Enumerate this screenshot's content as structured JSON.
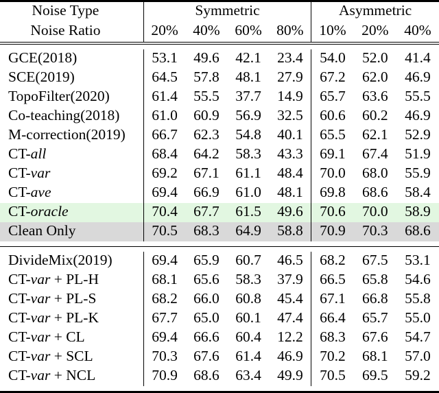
{
  "table": {
    "header": {
      "label_line1": "Noise Type",
      "label_line2": "Noise Ratio",
      "groups": [
        {
          "name": "Symmetric",
          "ratios": [
            "20%",
            "40%",
            "60%",
            "80%"
          ]
        },
        {
          "name": "Asymmetric",
          "ratios": [
            "10%",
            "20%",
            "40%"
          ]
        }
      ]
    },
    "highlight_colors": {
      "oracle_row": "#e2f7e1",
      "clean_only_row": "#d9d9d9"
    },
    "sections": [
      {
        "rows": [
          {
            "label_pre": "GCE(2018)",
            "label_it": "",
            "label_post": "",
            "values": [
              "53.1",
              "49.6",
              "42.1",
              "23.4",
              "54.0",
              "52.0",
              "41.4"
            ],
            "bold": [
              false,
              false,
              false,
              false,
              false,
              false,
              false
            ],
            "highlight": ""
          },
          {
            "label_pre": "SCE(2019)",
            "label_it": "",
            "label_post": "",
            "values": [
              "64.5",
              "57.8",
              "48.1",
              "27.9",
              "67.2",
              "62.0",
              "46.9"
            ],
            "bold": [
              false,
              false,
              false,
              false,
              false,
              false,
              false
            ],
            "highlight": ""
          },
          {
            "label_pre": "TopoFilter(2020)",
            "label_it": "",
            "label_post": "",
            "values": [
              "61.4",
              "55.5",
              "37.7",
              "14.9",
              "65.7",
              "63.6",
              "55.5"
            ],
            "bold": [
              false,
              false,
              false,
              false,
              false,
              false,
              false
            ],
            "highlight": ""
          },
          {
            "label_pre": "Co-teaching(2018)",
            "label_it": "",
            "label_post": "",
            "values": [
              "61.0",
              "60.9",
              "56.9",
              "32.5",
              "60.6",
              "60.2",
              "46.9"
            ],
            "bold": [
              false,
              false,
              false,
              false,
              false,
              false,
              false
            ],
            "highlight": ""
          },
          {
            "label_pre": "M-correction(2019)",
            "label_it": "",
            "label_post": "",
            "values": [
              "66.7",
              "62.3",
              "54.8",
              "40.1",
              "65.5",
              "62.1",
              "52.9"
            ],
            "bold": [
              false,
              false,
              false,
              false,
              false,
              false,
              false
            ],
            "highlight": ""
          },
          {
            "label_pre": "CT-",
            "label_it": "all",
            "label_post": "",
            "values": [
              "68.4",
              "64.2",
              "58.3",
              "43.3",
              "69.1",
              "67.4",
              "51.9"
            ],
            "bold": [
              false,
              false,
              false,
              false,
              false,
              false,
              false
            ],
            "highlight": ""
          },
          {
            "label_pre": "CT-",
            "label_it": "var",
            "label_post": "",
            "values": [
              "69.2",
              "67.1",
              "61.1",
              "48.4",
              "70.0",
              "68.0",
              "55.9"
            ],
            "bold": [
              false,
              true,
              true,
              true,
              true,
              false,
              false
            ],
            "highlight": ""
          },
          {
            "label_pre": "CT-",
            "label_it": "ave",
            "label_post": "",
            "values": [
              "69.4",
              "66.9",
              "61.0",
              "48.1",
              "69.8",
              "68.6",
              "58.4"
            ],
            "bold": [
              true,
              false,
              false,
              false,
              false,
              true,
              true
            ],
            "highlight": ""
          },
          {
            "label_pre": "CT-",
            "label_it": "oracle",
            "label_post": "",
            "values": [
              "70.4",
              "67.7",
              "61.5",
              "49.6",
              "70.6",
              "70.0",
              "58.9"
            ],
            "bold": [
              false,
              false,
              false,
              false,
              false,
              false,
              false
            ],
            "highlight": "green"
          },
          {
            "label_pre": "Clean Only",
            "label_it": "",
            "label_post": "",
            "values": [
              "70.5",
              "68.3",
              "64.9",
              "58.8",
              "70.9",
              "70.3",
              "68.6"
            ],
            "bold": [
              false,
              false,
              false,
              false,
              false,
              false,
              false
            ],
            "highlight": "gray"
          }
        ]
      },
      {
        "rows": [
          {
            "label_pre": "DivideMix(2019)",
            "label_it": "",
            "label_post": "",
            "values": [
              "69.4",
              "65.9",
              "60.7",
              "46.5",
              "68.2",
              "67.5",
              "53.1"
            ],
            "bold": [
              false,
              false,
              false,
              false,
              false,
              false,
              false
            ],
            "highlight": ""
          },
          {
            "label_pre": "CT-",
            "label_it": "var",
            "label_post": " + PL-H",
            "values": [
              "68.1",
              "65.6",
              "58.3",
              "37.9",
              "66.5",
              "65.8",
              "54.6"
            ],
            "bold": [
              false,
              false,
              false,
              false,
              false,
              false,
              false
            ],
            "highlight": ""
          },
          {
            "label_pre": "CT-",
            "label_it": "var",
            "label_post": " + PL-S",
            "values": [
              "68.2",
              "66.0",
              "60.8",
              "45.4",
              "67.1",
              "66.8",
              "55.8"
            ],
            "bold": [
              false,
              false,
              false,
              false,
              false,
              false,
              false
            ],
            "highlight": ""
          },
          {
            "label_pre": "CT-",
            "label_it": "var",
            "label_post": " + PL-K",
            "values": [
              "67.7",
              "65.0",
              "60.1",
              "47.4",
              "66.4",
              "65.7",
              "55.0"
            ],
            "bold": [
              false,
              false,
              false,
              false,
              false,
              false,
              false
            ],
            "highlight": ""
          },
          {
            "label_pre": "CT-",
            "label_it": "var",
            "label_post": " + CL",
            "values": [
              "69.4",
              "66.6",
              "60.4",
              "12.2",
              "68.3",
              "67.6",
              "54.7"
            ],
            "bold": [
              false,
              false,
              false,
              false,
              false,
              false,
              false
            ],
            "highlight": ""
          },
          {
            "label_pre": "CT-",
            "label_it": "var",
            "label_post": " + SCL",
            "values": [
              "70.3",
              "67.6",
              "61.4",
              "46.9",
              "70.2",
              "68.1",
              "57.0"
            ],
            "bold": [
              false,
              false,
              false,
              false,
              false,
              false,
              false
            ],
            "highlight": ""
          },
          {
            "label_pre": "CT-",
            "label_it": "var",
            "label_post": " + NCL",
            "values": [
              "70.9",
              "68.6",
              "63.4",
              "49.9",
              "70.5",
              "69.5",
              "59.2"
            ],
            "bold": [
              true,
              true,
              true,
              true,
              true,
              true,
              true
            ],
            "highlight": ""
          }
        ]
      }
    ]
  }
}
